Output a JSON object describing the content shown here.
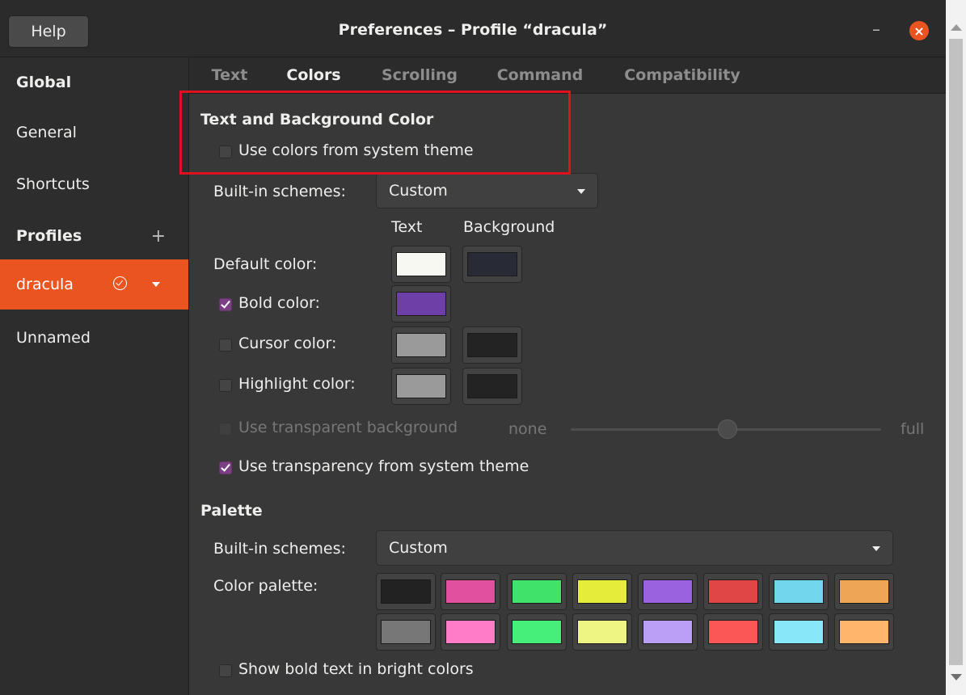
{
  "window": {
    "title": "Preferences – Profile “dracula”",
    "help_label": "Help",
    "minimize_glyph": "–",
    "close_glyph": "×"
  },
  "sidebar": {
    "global_label": "Global",
    "general_label": "General",
    "shortcuts_label": "Shortcuts",
    "profiles_label": "Profiles",
    "add_glyph": "+",
    "profiles": [
      {
        "label": "dracula",
        "active": true
      },
      {
        "label": "Unnamed",
        "active": false
      }
    ]
  },
  "tabs": [
    {
      "label": "Text",
      "active": false
    },
    {
      "label": "Colors",
      "active": true
    },
    {
      "label": "Scrolling",
      "active": false
    },
    {
      "label": "Command",
      "active": false
    },
    {
      "label": "Compatibility",
      "active": false
    }
  ],
  "colors": {
    "section_title": "Text and Background Color",
    "use_system_colors": {
      "label": "Use colors from system theme",
      "checked": false
    },
    "builtin_label": "Built-in schemes:",
    "builtin_value": "Custom",
    "col_text": "Text",
    "col_background": "Background",
    "default_color": {
      "label": "Default color:",
      "text": "#f8f8f2",
      "background": "#282a36"
    },
    "bold_color": {
      "label": "Bold color:",
      "checked": true,
      "color": "#6f3fa8"
    },
    "cursor_color": {
      "label": "Cursor color:",
      "checked": false,
      "text": "#9a9a9a",
      "background": "#232323"
    },
    "highlight_color": {
      "label": "Highlight color:",
      "checked": false,
      "text": "#9a9a9a",
      "background": "#232323"
    },
    "transparent_bg": {
      "label": "Use transparent background",
      "checked": false,
      "min_label": "none",
      "max_label": "full",
      "value": 0.5
    },
    "system_transparency": {
      "label": "Use transparency from system theme",
      "checked": true
    }
  },
  "palette": {
    "title": "Palette",
    "builtin_label": "Built-in schemes:",
    "builtin_value": "Custom",
    "palette_label": "Color palette:",
    "row1": [
      "#222222",
      "#e0509f",
      "#40e26a",
      "#e5ec3a",
      "#9b62e0",
      "#e04646",
      "#72d6ec",
      "#eea656"
    ],
    "row2": [
      "#777777",
      "#ff7cc8",
      "#45ef7a",
      "#eef583",
      "#bb9ef6",
      "#fb5757",
      "#86e8f8",
      "#ffb56a"
    ],
    "bright_bold": {
      "label": "Show bold text in bright colors",
      "checked": false
    }
  }
}
